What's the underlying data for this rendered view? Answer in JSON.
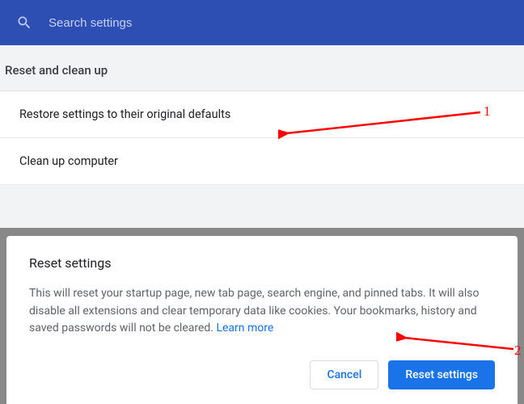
{
  "search": {
    "placeholder": "Search settings"
  },
  "section": {
    "title": "Reset and clean up",
    "items": [
      {
        "label": "Restore settings to their original defaults"
      },
      {
        "label": "Clean up computer"
      }
    ]
  },
  "dialog": {
    "title": "Reset settings",
    "body": "This will reset your startup page, new tab page, search engine, and pinned tabs. It will also disable all extensions and clear temporary data like cookies. Your bookmarks, history and saved passwords will not be cleared. ",
    "learn_more": "Learn more",
    "cancel": "Cancel",
    "confirm": "Reset settings"
  },
  "annotations": {
    "num1": "1",
    "num2": "2"
  }
}
